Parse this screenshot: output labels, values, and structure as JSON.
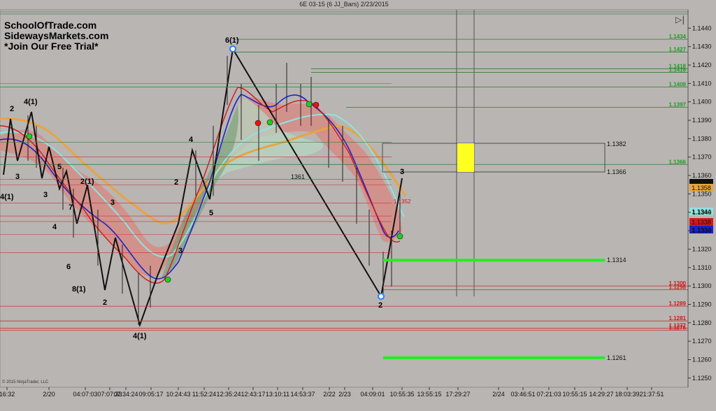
{
  "window": {
    "title": "6E 03-15 (6 JJ_Bars)  2/23/2015",
    "copyright": "© 2015 NinjaTrader, LLC"
  },
  "brand": {
    "line1": "SchoolOfTrade.com",
    "line2": "SidewaysMarkets.com",
    "line3": "*Join Our Free Trial*"
  },
  "colors": {
    "background": "#b9b5b3",
    "green_level": "#1f9c1f",
    "red_level": "#d01818",
    "bright_green": "#22ee22",
    "highlight_box": "#ffff22"
  },
  "chart_data": {
    "type": "line",
    "instrument": "6E 03-15",
    "ylim": [
      1.1245,
      1.145
    ],
    "y_ticks": [
      "1.1440",
      "1.1430",
      "1.1420",
      "1.1410",
      "1.1400",
      "1.1390",
      "1.1380",
      "1.1370",
      "1.1360",
      "1.1350",
      "1.1340",
      "1.1330",
      "1.1320",
      "1.1310",
      "1.1300",
      "1.1290",
      "1.1280",
      "1.1270",
      "1.1260",
      "1.1250"
    ],
    "x_ticks": [
      "16:32",
      "2/20",
      "04:07:03",
      "07:07:33",
      "07:34:24",
      "09:05:17",
      "10:24:43",
      "11:52:24",
      "12:35:24",
      "12:43:17",
      "13:10:11",
      "14:53:37",
      "2/22",
      "2/23",
      "04:09:01",
      "10:55:35",
      "13:55:15",
      "17:29:27",
      "2/24",
      "03:46:51",
      "07:21:03",
      "10:55:15",
      "14:29:27",
      "18:03:39",
      "21:37:51"
    ],
    "price_badges": [
      {
        "label": "1.1360",
        "color": "#111111",
        "text_color": "#ffffff"
      },
      {
        "label": "1.1358",
        "color": "#e8a441",
        "text_color": "#111111"
      },
      {
        "label": "1.1344",
        "color": "#8fe3df",
        "text_color": "#111111"
      },
      {
        "label": "1.1338",
        "color": "#d41818",
        "text_color": "#ffffff"
      },
      {
        "label": "1.1334",
        "color": "#1b22c9",
        "text_color": "#ffffff"
      }
    ],
    "green_levels": [
      {
        "value": 1.1434,
        "label": "1.1434"
      },
      {
        "value": 1.1427,
        "label": "1.1427"
      },
      {
        "value": 1.1418,
        "label": "1.1418"
      },
      {
        "value": 1.1416,
        "label": "1.1416"
      },
      {
        "value": 1.1408,
        "label": "1.1408"
      },
      {
        "value": 1.1397,
        "label": "1.1397"
      },
      {
        "value": 1.1366,
        "label": "1.1366"
      }
    ],
    "red_levels": [
      {
        "value": 1.13,
        "label": "1.1300"
      },
      {
        "value": 1.1298,
        "label": "1.1298"
      },
      {
        "value": 1.1289,
        "label": "1.1289"
      },
      {
        "value": 1.1281,
        "label": "1.1281"
      },
      {
        "value": 1.1277,
        "label": "1.1277"
      },
      {
        "value": 1.1276,
        "label": "1.1276"
      }
    ],
    "box_labels": [
      "1.1382",
      "1.1366"
    ],
    "target_levels": [
      {
        "value": 1.1314,
        "label": "1.1314"
      },
      {
        "value": 1.1261,
        "label": "1.1261"
      }
    ],
    "annotations": {
      "mid_label": "1361",
      "small_red_label": "1.1352"
    },
    "wave_labels": [
      "4(1)",
      "2",
      "3",
      "4(1)",
      "3",
      "2",
      "5",
      "2(1)",
      "7",
      "4",
      "6",
      "3",
      "8(1)",
      "2",
      "4(1)",
      "3",
      "2",
      "4",
      "5",
      "6(1)",
      "3",
      "2"
    ]
  }
}
